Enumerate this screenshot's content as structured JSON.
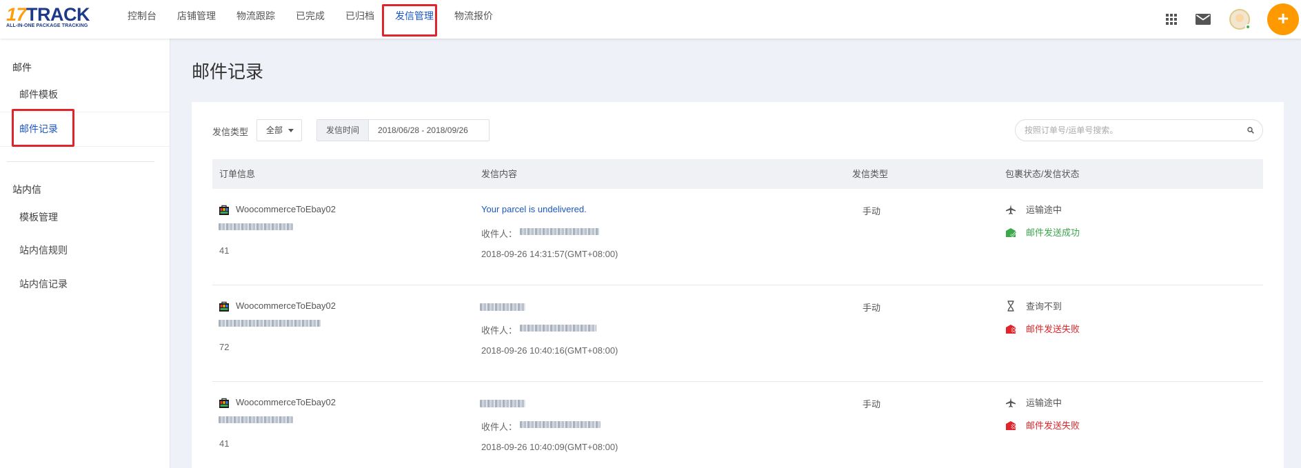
{
  "logo": {
    "brand_num": "17",
    "brand_text": "TRACK",
    "tagline": "ALL-IN-ONE PACKAGE TRACKING"
  },
  "nav": {
    "items": [
      {
        "label": "控制台"
      },
      {
        "label": "店铺管理"
      },
      {
        "label": "物流跟踪"
      },
      {
        "label": "已完成"
      },
      {
        "label": "已归档"
      },
      {
        "label": "发信管理",
        "active": true
      },
      {
        "label": "物流报价"
      }
    ]
  },
  "header_icons": {
    "apps": "apps-grid-icon",
    "mail": "mail-icon",
    "add": "+"
  },
  "sidebar": {
    "group1": "邮件",
    "group1_items": [
      "邮件模板",
      "邮件记录"
    ],
    "group2": "站内信",
    "group2_items": [
      "模板管理",
      "站内信规则",
      "站内信记录"
    ]
  },
  "page_title": "邮件记录",
  "filters": {
    "type_label": "发信类型",
    "type_value": "全部",
    "date_label": "发信时间",
    "date_value": "2018/06/28 - 2018/09/26",
    "search_placeholder": "按照订单号/运单号搜索。"
  },
  "table": {
    "headers": [
      "订单信息",
      "发信内容",
      "发信类型",
      "包裹状态/发信状态"
    ],
    "rows": [
      {
        "shop": "WoocommerceToEbay02",
        "count": "41",
        "message": "Your parcel is undelivered.",
        "receiver_label": "收件人：",
        "time": "2018-09-26 14:31:57(GMT+08:00)",
        "type": "手动",
        "package_status": "运输途中",
        "package_icon": "airplane-icon",
        "mail_status": "邮件发送成功",
        "mail_state": "success"
      },
      {
        "shop": "WoocommerceToEbay02",
        "count": "72",
        "message": "",
        "receiver_label": "收件人：",
        "time": "2018-09-26 10:40:16(GMT+08:00)",
        "type": "手动",
        "package_status": "查询不到",
        "package_icon": "hourglass-icon",
        "mail_status": "邮件发送失败",
        "mail_state": "fail"
      },
      {
        "shop": "WoocommerceToEbay02",
        "count": "41",
        "message": "",
        "receiver_label": "收件人：",
        "time": "2018-09-26 10:40:09(GMT+08:00)",
        "type": "手动",
        "package_status": "运输途中",
        "package_icon": "airplane-icon",
        "mail_status": "邮件发送失败",
        "mail_state": "fail"
      }
    ]
  },
  "colors": {
    "accent": "#1a56c4",
    "brand_orange": "#ff9900",
    "success": "#3aa84b",
    "fail": "#e0242b",
    "highlight": "#e0242b"
  }
}
